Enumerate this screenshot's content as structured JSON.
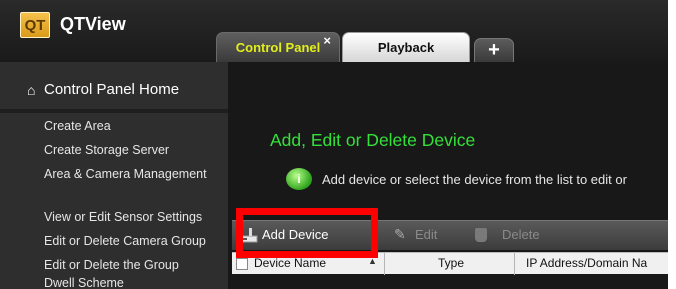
{
  "app": {
    "logo_text": "QT",
    "title": "QTView"
  },
  "tabs": [
    {
      "label": "Control Panel",
      "close": "×",
      "active": true
    },
    {
      "label": "Playback",
      "active": false
    },
    {
      "label": "+"
    }
  ],
  "sidebar": {
    "home_label": "Control Panel Home",
    "items": [
      "Create Area",
      "Create Storage Server",
      "Area & Camera Management",
      "View or Edit Sensor Settings",
      "Edit or Delete Camera Group",
      "Edit or Delete the Group",
      "Dwell Scheme"
    ]
  },
  "main": {
    "heading": "Add, Edit or Delete Device",
    "hint": "Add device or select the device from the list to edit or"
  },
  "toolbar": {
    "add_label": "Add Device",
    "edit_label": "Edit",
    "delete_label": "Delete"
  },
  "table": {
    "columns": [
      "Device Name",
      "Type",
      "IP Address/Domain Na"
    ]
  },
  "colors": {
    "accent_tab": "#e2ef1a",
    "heading": "#34e03a",
    "highlight": "#ff0000"
  }
}
